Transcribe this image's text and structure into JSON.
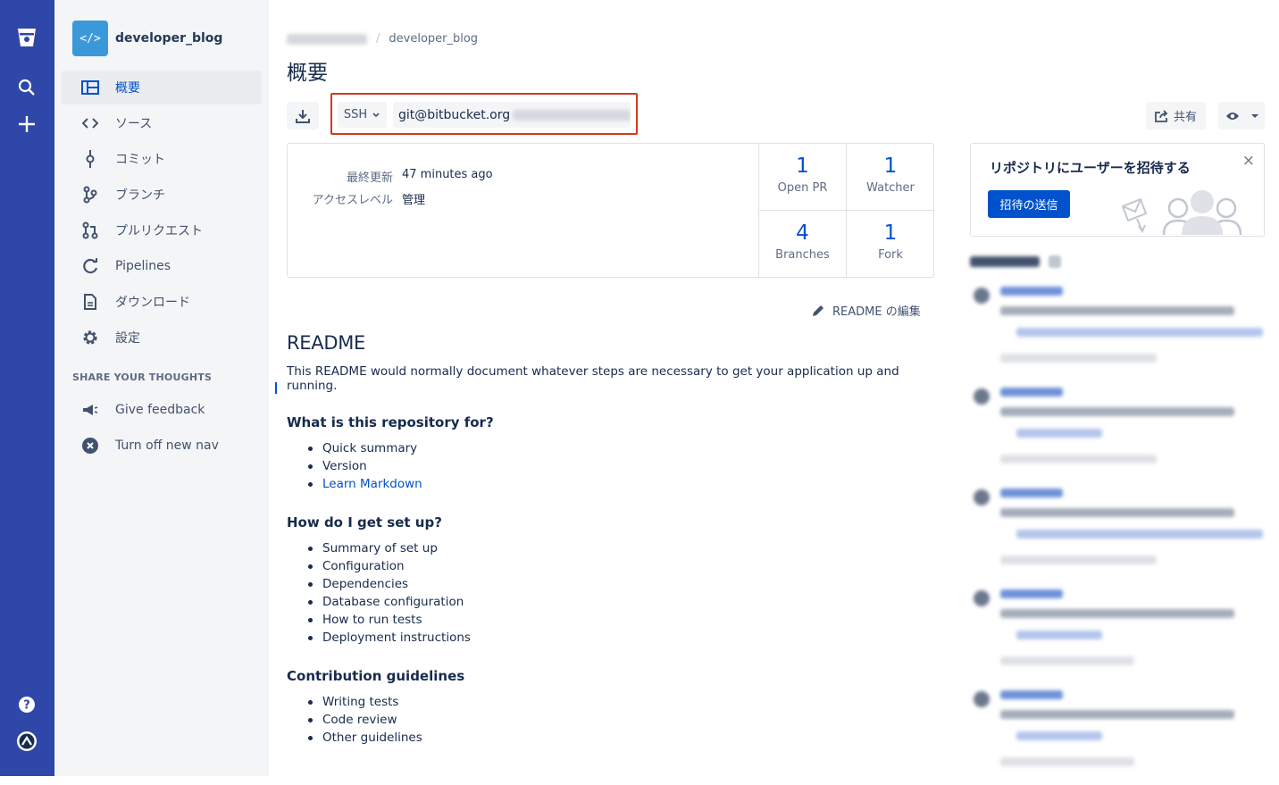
{
  "global_nav": {
    "icons": [
      "bitbucket-logo-icon",
      "search-icon",
      "plus-icon",
      "help-icon",
      "profile-avatar-icon"
    ]
  },
  "repo": {
    "name": "developer_blog",
    "avatar_text": "</>"
  },
  "sidebar": {
    "items": [
      {
        "label": "概要",
        "icon": "overview-icon",
        "active": true
      },
      {
        "label": "ソース",
        "icon": "code-icon"
      },
      {
        "label": "コミット",
        "icon": "commit-icon"
      },
      {
        "label": "ブランチ",
        "icon": "branch-icon"
      },
      {
        "label": "プルリクエスト",
        "icon": "pull-request-icon"
      },
      {
        "label": "Pipelines",
        "icon": "pipelines-icon"
      },
      {
        "label": "ダウンロード",
        "icon": "download-file-icon"
      },
      {
        "label": "設定",
        "icon": "gear-icon"
      }
    ],
    "section_title": "SHARE YOUR THOUGHTS",
    "feedback": [
      {
        "label": "Give feedback",
        "icon": "megaphone-icon"
      },
      {
        "label": "Turn off new nav",
        "icon": "close-circle-icon"
      }
    ]
  },
  "breadcrumb": {
    "current": "developer_blog",
    "separator": "/"
  },
  "page_title": "概要",
  "clone": {
    "protocol": "SSH",
    "url": "git@bitbucket.org"
  },
  "header_actions": {
    "share_label": "共有"
  },
  "info": {
    "last_updated_label": "最終更新",
    "last_updated_value": "47 minutes ago",
    "access_label": "アクセスレベル",
    "access_value": "管理"
  },
  "stats": [
    {
      "num": "1",
      "label": "Open PR"
    },
    {
      "num": "1",
      "label": "Watcher"
    },
    {
      "num": "4",
      "label": "Branches"
    },
    {
      "num": "1",
      "label": "Fork"
    }
  ],
  "readme_edit_label": "README の編集",
  "readme": {
    "title": "README",
    "intro": "This README would normally document whatever steps are necessary to get your application up and running.",
    "sections": [
      {
        "heading": "What is this repository for?",
        "items": [
          "Quick summary",
          "Version",
          "Learn Markdown"
        ]
      },
      {
        "heading": "How do I get set up?",
        "items": [
          "Summary of set up",
          "Configuration",
          "Dependencies",
          "Database configuration",
          "How to run tests",
          "Deployment instructions"
        ]
      },
      {
        "heading": "Contribution guidelines",
        "items": [
          "Writing tests",
          "Code review",
          "Other guidelines"
        ]
      }
    ]
  },
  "invite": {
    "title": "リポジトリにユーザーを招待する",
    "button": "招待の送信",
    "close": "×"
  }
}
